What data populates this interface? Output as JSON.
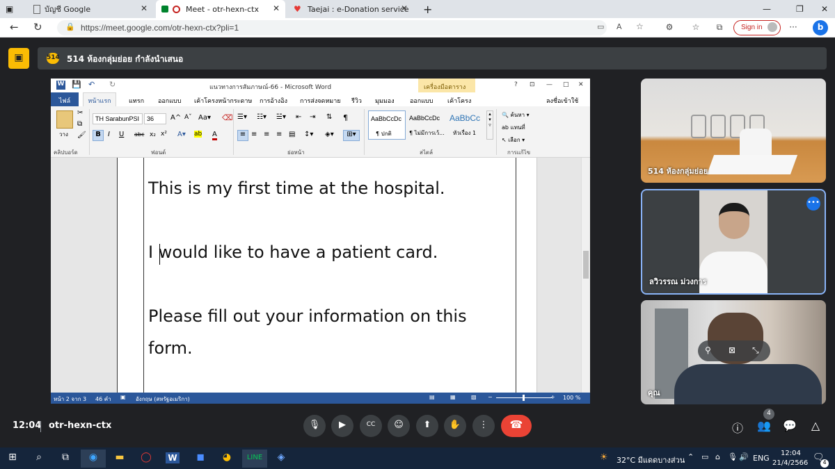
{
  "browser": {
    "tabs": [
      {
        "title": "บัญชี Google",
        "icon": "doc-icon"
      },
      {
        "title": "Meet - otr-hexn-ctx",
        "icon": "meet-icon"
      },
      {
        "title": "Taejai : e-Donation service",
        "icon": "heart-icon"
      }
    ],
    "url": "https://meet.google.com/otr-hexn-ctx?pli=1",
    "signin_label": "Sign in"
  },
  "meet": {
    "presenting_badge": "514",
    "presenting_text": "514 ห้องกลุ่มย่อย กำลังนำเสนอ",
    "time": "12:04",
    "meeting_code": "otr-hexn-ctx",
    "people_count": "4",
    "tiles": [
      {
        "name": "514 ห้องกลุ่มย่อย"
      },
      {
        "name": "ลวิวรรณ ม่วงการ"
      },
      {
        "name": "คุณ"
      }
    ]
  },
  "word": {
    "title": "แนวทางการสัมภาษณ์-66 - Microsoft Word",
    "tool_tab_header": "เครื่องมือตาราง",
    "tabs": [
      "ไฟล์",
      "หน้าแรก",
      "แทรก",
      "ออกแบบ",
      "เค้าโครงหน้ากระดาษ",
      "การอ้างอิง",
      "การส่งจดหมาย",
      "รีวิว",
      "มุมมอง",
      "ออกแบบ",
      "เค้าโครง"
    ],
    "signin": "ลงชื่อเข้าใช้",
    "font_name": "TH SarabunPSI",
    "font_size": "36",
    "groups": [
      "คลิปบอร์ด",
      "ฟอนต์",
      "ย่อหน้า",
      "สไตล์",
      "การแก้ไข"
    ],
    "paste_label": "วาง",
    "styles": [
      {
        "sample": "AaBbCcDc",
        "name": "¶ ปกติ"
      },
      {
        "sample": "AaBbCcDc",
        "name": "¶ ไม่มีการเว้..."
      },
      {
        "sample": "AaBbCc",
        "name": "หัวเรื่อง 1"
      }
    ],
    "editing": [
      "ค้นหา",
      "แทนที่",
      "เลือก"
    ],
    "doc_lines": [
      "This is my first time at the hospital.",
      "I would like to have a patient card.",
      "Please fill out your information on this",
      "form."
    ],
    "status": {
      "page": "หน้า 2 จาก 3",
      "words": "46 คำ",
      "lang": "อังกฤษ (สหรัฐอเมริกา)",
      "zoom": "100 %"
    }
  },
  "taskbar": {
    "weather": "32°C  มีแดดบางส่วน",
    "lang": "ENG",
    "time": "12:04",
    "date": "21/4/2566",
    "notif_count": "4"
  }
}
